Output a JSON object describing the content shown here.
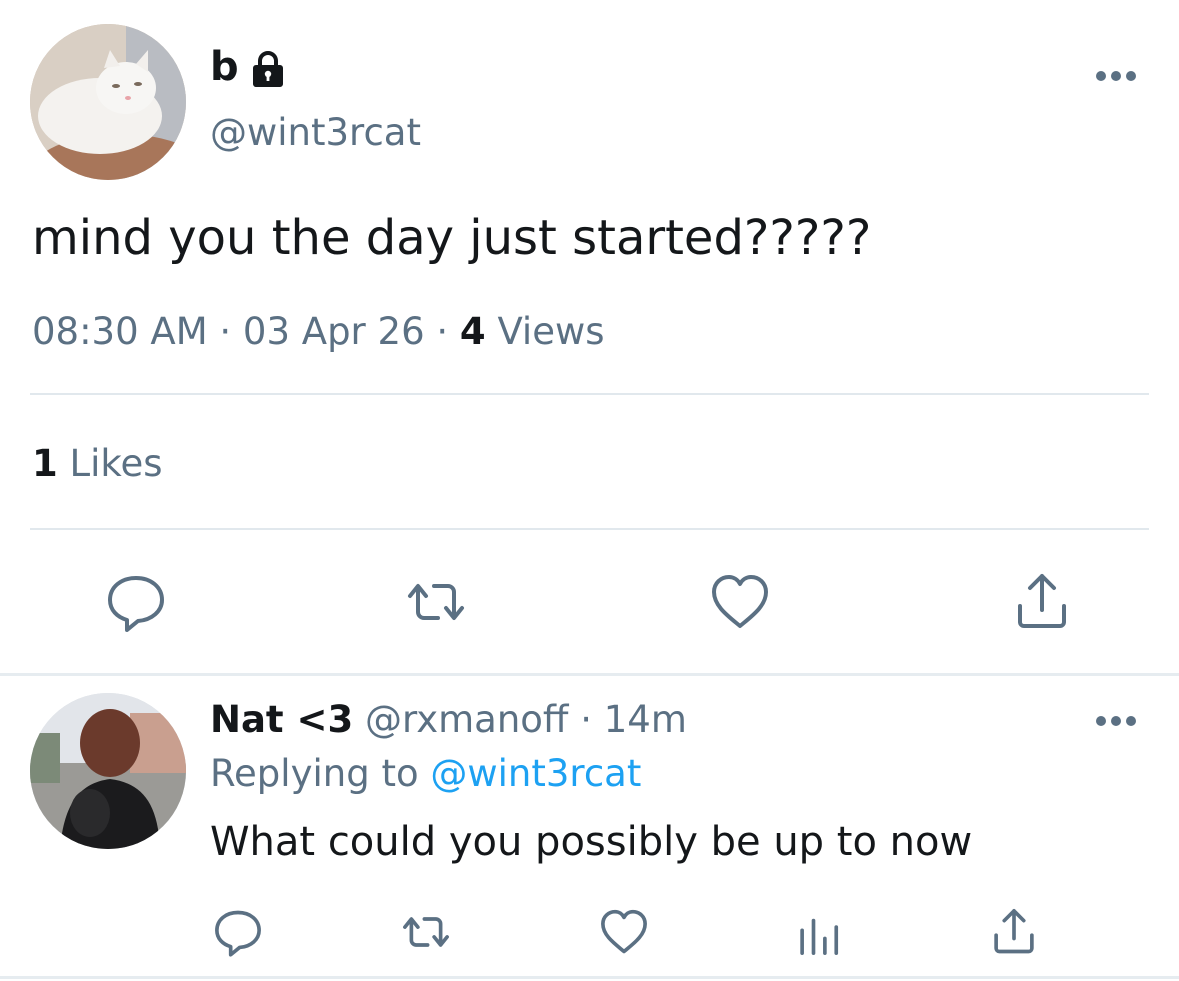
{
  "main_tweet": {
    "display_name": "b",
    "handle": "@wint3rcat",
    "text": "mind you the day just started?????",
    "time": "08:30 AM",
    "sep1": "·",
    "date": "03 Apr 26",
    "sep2": "·",
    "views_count": "4",
    "views_label": "Views",
    "likes_count": "1",
    "likes_label": "Likes",
    "icons": [
      "lock-icon",
      "more-icon",
      "reply-icon",
      "retweet-icon",
      "like-icon",
      "share-icon"
    ]
  },
  "reply_tweet": {
    "display_name": "Nat <3",
    "handle": "@rxmanoff",
    "sep": "·",
    "time": "14m",
    "replying_prefix": "Replying to",
    "replying_handle": "@wint3rcat",
    "text": "What could you possibly be up to now",
    "icons": [
      "reply-icon",
      "retweet-icon",
      "like-icon",
      "analytics-icon",
      "share-icon"
    ]
  },
  "colors": {
    "text": "#14171a",
    "secondary": "#5b7083",
    "link": "#1da1f2",
    "divider": "#e1e8ed"
  }
}
